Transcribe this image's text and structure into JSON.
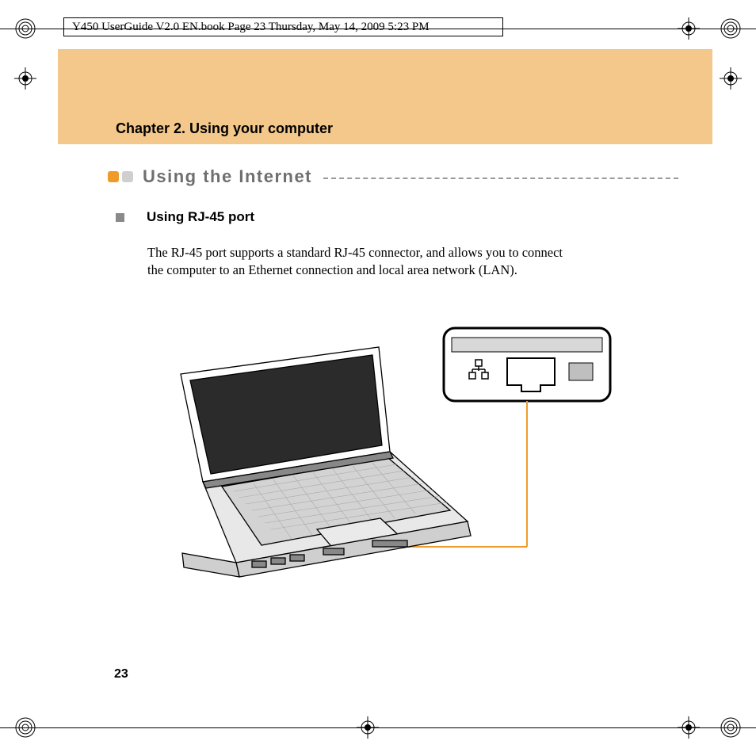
{
  "print_header": "Y450 UserGuide V2.0 EN.book  Page 23  Thursday, May 14, 2009  5:23 PM",
  "chapter_title": "Chapter 2. Using your computer",
  "section_title": "Using the Internet",
  "subsection_title": "Using RJ-45 port",
  "body_text": "The RJ-45 port supports a standard RJ-45 connector, and allows you to connect the computer to an Ethernet connection and local area network (LAN).",
  "page_number": "23",
  "colors": {
    "banner": "#f3c88a",
    "bullet_orange": "#f09a2a",
    "bullet_grey": "#cfcfcf",
    "section_grey": "#6f6f6f",
    "callout_orange": "#f09a2a"
  }
}
